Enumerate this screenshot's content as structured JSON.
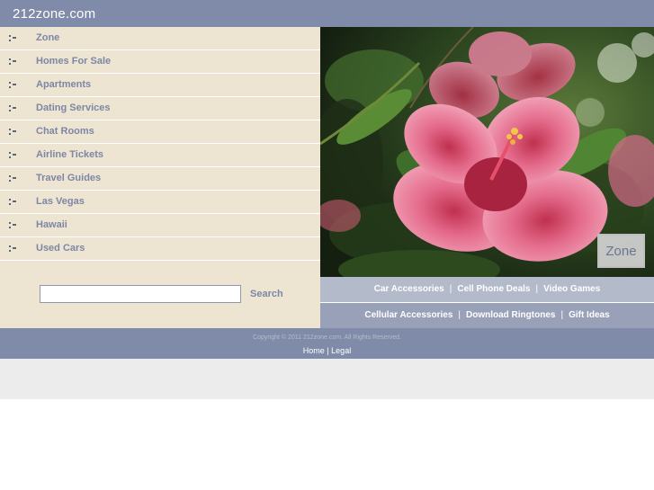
{
  "header": {
    "site_title": "212zone.com"
  },
  "sidebar": {
    "items": [
      {
        "label": "Zone"
      },
      {
        "label": "Homes For Sale"
      },
      {
        "label": "Apartments"
      },
      {
        "label": "Dating Services"
      },
      {
        "label": "Chat Rooms"
      },
      {
        "label": "Airline Tickets"
      },
      {
        "label": "Travel Guides"
      },
      {
        "label": "Las Vegas"
      },
      {
        "label": "Hawaii"
      },
      {
        "label": "Used Cars"
      }
    ]
  },
  "search": {
    "value": "",
    "button_label": "Search"
  },
  "hero": {
    "badge": "Zone"
  },
  "links_row1": [
    "Car Accessories",
    "Cell Phone Deals",
    "Video Games"
  ],
  "links_row2": [
    "Cellular Accessories",
    "Download Ringtones",
    "Gift Ideas"
  ],
  "link_separator": "|",
  "footer": {
    "copyright": "Copyright © 2011 212zone.com. All Rights Reserved.",
    "home_label": "Home",
    "separator": "|",
    "legal_label": "Legal"
  },
  "colors": {
    "header_bg": "#7f8ba8",
    "sidebar_bg": "#eee4d2",
    "link_text": "#7c87a6",
    "band1_bg": "#b3bac9",
    "band2_bg": "#98a1b8"
  }
}
